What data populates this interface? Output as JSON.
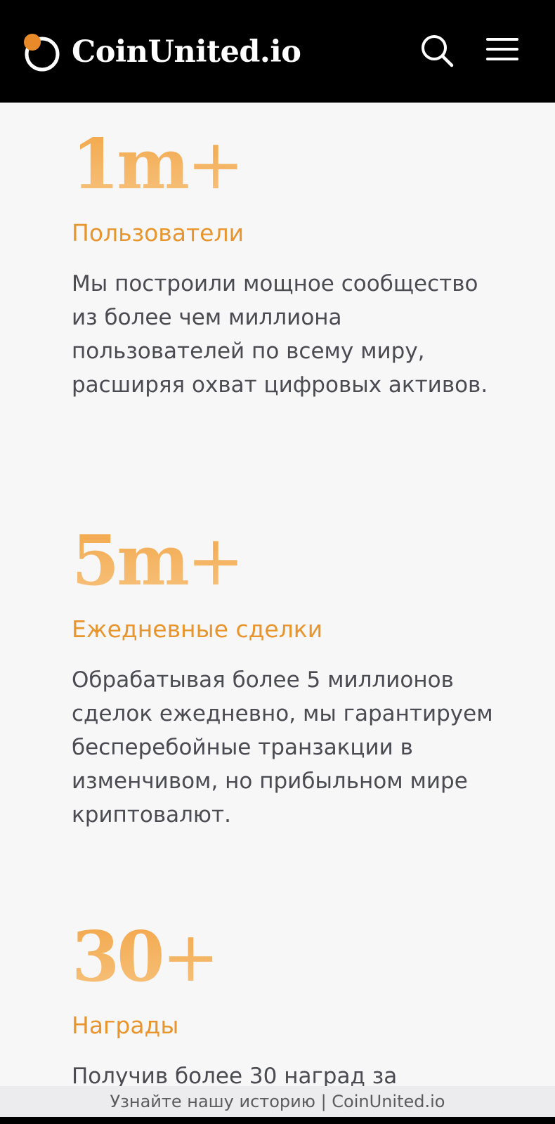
{
  "header": {
    "logo_text": "CoinUnited.io",
    "search_icon": "search-icon",
    "menu_icon": "hamburger-menu-icon"
  },
  "colors": {
    "header_bg": "#000000",
    "page_bg": "#f7f7f8",
    "accent": "#e8952d",
    "body_text": "#4b4b52",
    "logo_dot": "#e8892a"
  },
  "stats": [
    {
      "number": "1m",
      "suffix": "+",
      "title": "Пользователи",
      "description": "Мы построили мощное сообщество из более чем миллиона пользователей по всему миру, расширяя охват цифровых активов."
    },
    {
      "number": "5m",
      "suffix": "+",
      "title": "Ежедневные сделки",
      "description": "Обрабатывая более 5 миллионов сделок ежедневно, мы гарантируем бесперебойные транзакции в изменчивом, но прибыльном мире криптовалют."
    },
    {
      "number": "30",
      "suffix": "+",
      "title": "Награды",
      "description": "Получив более 30 наград за"
    }
  ],
  "footer": {
    "text": "Узнайте нашу историю | CoinUnited.io"
  }
}
